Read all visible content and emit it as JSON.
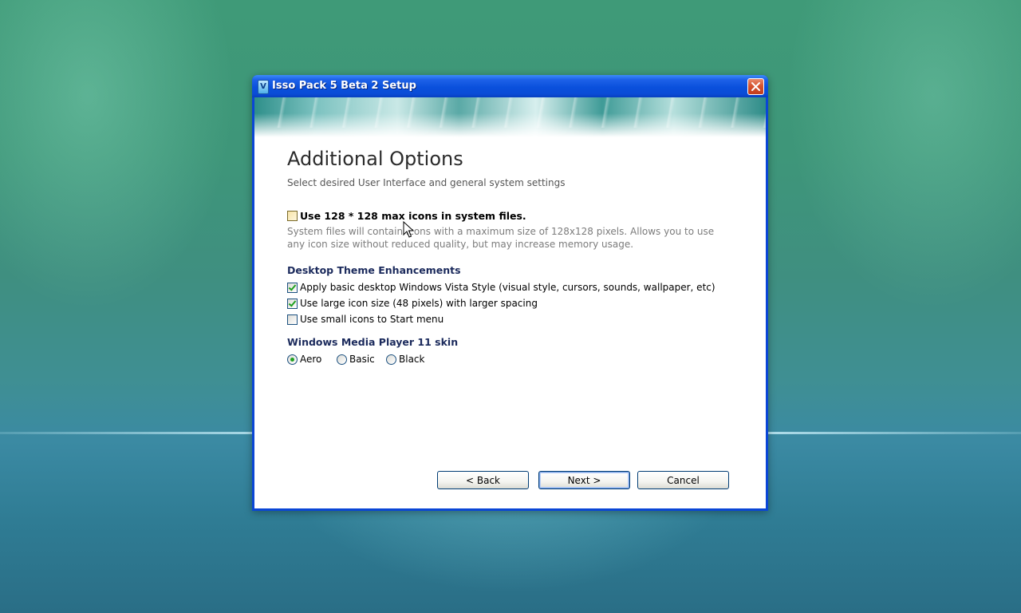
{
  "window": {
    "title": "Isso Pack 5 Beta 2 Setup",
    "icon": "installer-icon",
    "app_icon_letter": "V"
  },
  "page": {
    "heading": "Additional Options",
    "subheading": "Select desired User Interface and general system settings"
  },
  "icons_option": {
    "label": "Use 128 * 128 max icons in system files.",
    "checked": false,
    "description": "System files will contain icons with a maximum size of 128x128 pixels.  Allows you to use any icon size without reduced quality, but may increase memory usage."
  },
  "desktop_theme": {
    "title": "Desktop Theme Enhancements",
    "options": [
      {
        "label": "Apply basic desktop Windows Vista Style (visual style, cursors, sounds, wallpaper, etc)",
        "checked": true
      },
      {
        "label": "Use large icon size (48 pixels) with larger spacing",
        "checked": true
      },
      {
        "label": "Use small icons to Start menu",
        "checked": false
      }
    ]
  },
  "wmp_skin": {
    "title": "Windows Media Player 11 skin",
    "options": [
      {
        "label": "Aero",
        "selected": true
      },
      {
        "label": "Basic",
        "selected": false
      },
      {
        "label": "Black",
        "selected": false
      }
    ]
  },
  "buttons": {
    "back": "< Back",
    "next": "Next >",
    "cancel": "Cancel"
  },
  "colors": {
    "titlebar": "#0a50dc",
    "section_title": "#1b2a5c",
    "check_mark": "#21a121",
    "close_button": "#d6532f"
  }
}
